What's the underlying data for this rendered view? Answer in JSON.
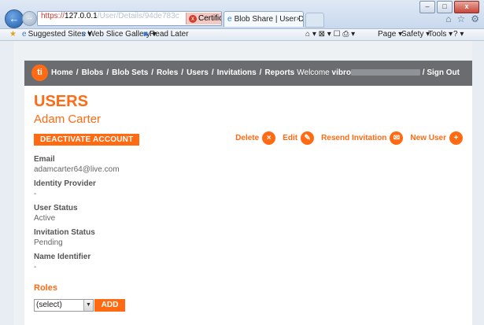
{
  "browser": {
    "address": {
      "scheme": "https://",
      "host": "127.0.0.1",
      "path": "/User/Details/94de783c"
    },
    "certificate_label": "Certificate e...",
    "tab_title": "Blob Share | User Details",
    "favorites": {
      "suggested": "Suggested Sites",
      "gallery": "Web Slice Gallery",
      "read_later": "Read Later"
    },
    "commands": {
      "page": "Page",
      "safety": "Safety",
      "tools": "Tools"
    }
  },
  "app": {
    "logo_text": "ti",
    "nav": [
      "Home",
      "Blobs",
      "Blob Sets",
      "Roles",
      "Users",
      "Invitations",
      "Reports"
    ],
    "welcome_prefix": "Welcome",
    "username": "vibro",
    "sign_out": "Sign Out"
  },
  "page": {
    "title": "USERS",
    "user_name": "Adam Carter",
    "deactivate_label": "DEACTIVATE ACCOUNT",
    "actions": {
      "delete": "Delete",
      "edit": "Edit",
      "resend": "Resend Invitation",
      "new_user": "New User"
    },
    "fields": [
      {
        "label": "Email",
        "value": "adamcarter64@live.com"
      },
      {
        "label": "Identity Provider",
        "value": "-"
      },
      {
        "label": "User Status",
        "value": "Active"
      },
      {
        "label": "Invitation Status",
        "value": "Pending"
      },
      {
        "label": "Name Identifier",
        "value": "-"
      }
    ],
    "roles_title": "Roles",
    "roles_select_value": "(select)",
    "add_label": "ADD"
  },
  "colors": {
    "accent": "#ff6a13",
    "nav_bg": "#6a6c6f"
  }
}
